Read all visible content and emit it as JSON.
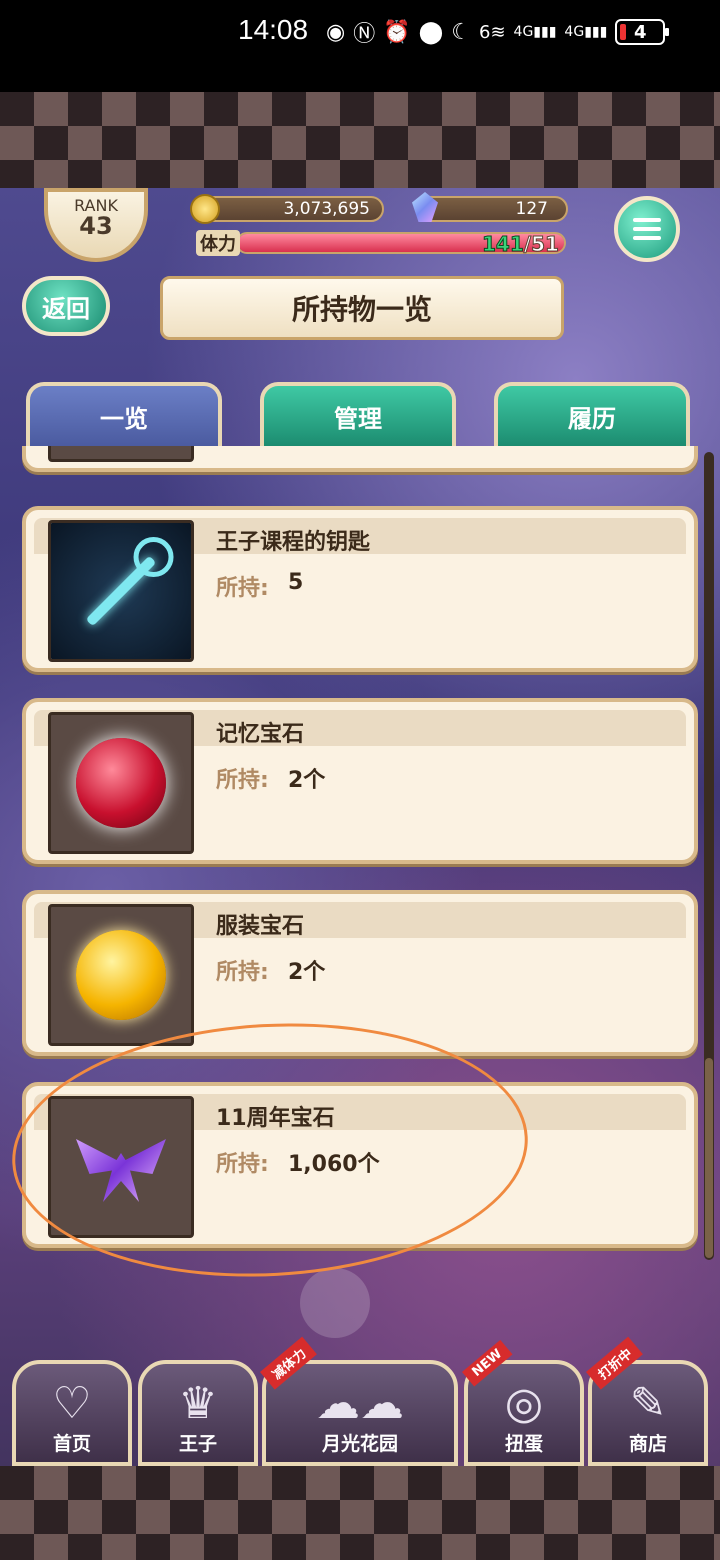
{
  "status_bar": {
    "time": "14:08",
    "icons": [
      "eye-icon",
      "nfc-icon",
      "alarm-icon",
      "location-icon",
      "moon-icon",
      "wifi-icon",
      "signal-4g-icon",
      "signal-4g-icon"
    ],
    "wifi_badge": "6",
    "net_label_1": "4G",
    "net_label_2": "4G",
    "battery": "4"
  },
  "header": {
    "rank_label": "RANK",
    "rank_value": "43",
    "coins": "3,073,695",
    "gems": "127",
    "stamina_label": "体力",
    "stamina_current": "141",
    "stamina_separator": "/",
    "stamina_max": "51",
    "stamina_fill_fraction": 1.0,
    "back_label": "返回",
    "page_title": "所持物一览"
  },
  "tabs": [
    {
      "label": "一览",
      "active": true
    },
    {
      "label": "管理",
      "active": false
    },
    {
      "label": "履历",
      "active": false
    }
  ],
  "items": [
    {
      "name": "王子课程的钥匙",
      "qty_label": "所持:",
      "qty_value": "5",
      "icon": "key-icon"
    },
    {
      "name": "记忆宝石",
      "qty_label": "所持:",
      "qty_value": "2个",
      "icon": "red-gem-icon"
    },
    {
      "name": "服装宝石",
      "qty_label": "所持:",
      "qty_value": "2个",
      "icon": "yellow-gem-icon"
    },
    {
      "name": "11周年宝石",
      "qty_label": "所持:",
      "qty_value": "1,060个",
      "icon": "butterfly-gem-icon"
    }
  ],
  "nav": [
    {
      "label": "首页",
      "icon": "heart-icon",
      "badge": ""
    },
    {
      "label": "王子",
      "icon": "crown-icon",
      "badge": ""
    },
    {
      "label": "月光花园",
      "icon": "garden-icon",
      "badge": "减体力"
    },
    {
      "label": "扭蛋",
      "icon": "ring-icon",
      "badge": "NEW"
    },
    {
      "label": "商店",
      "icon": "shop-icon",
      "badge": "打折中"
    }
  ],
  "colors": {
    "accent_green": "#1c9a7c",
    "frame_gold": "#c9a46a",
    "card_bg": "#fbf2e2",
    "annotation": "#f08a40"
  }
}
